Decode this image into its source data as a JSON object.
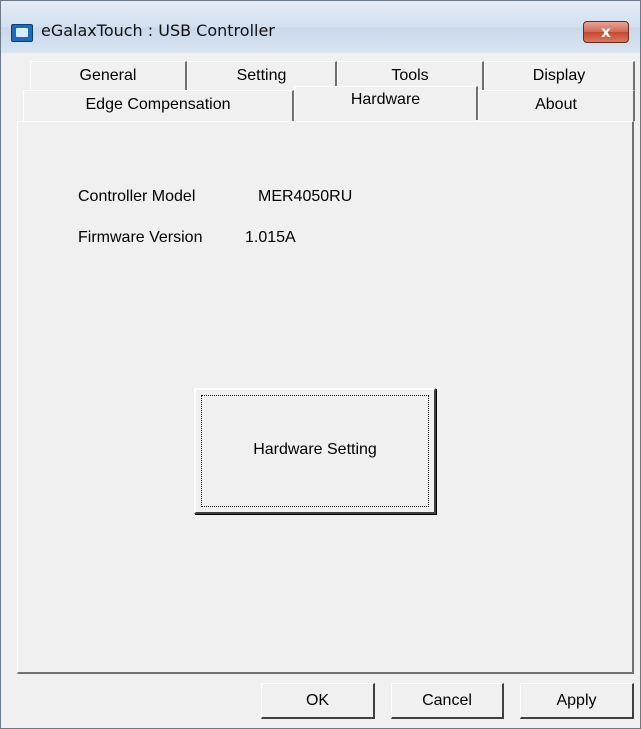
{
  "window": {
    "title": "eGalaxTouch : USB Controller",
    "close_glyph": "x"
  },
  "tabs": {
    "row_back": [
      {
        "label": "General"
      },
      {
        "label": "Setting"
      },
      {
        "label": "Tools"
      },
      {
        "label": "Display"
      }
    ],
    "row_front": [
      {
        "label": "Edge Compensation"
      },
      {
        "label": "Hardware",
        "selected": true
      },
      {
        "label": "About"
      }
    ]
  },
  "hardware": {
    "controller_model_label": "Controller Model",
    "controller_model_value": "MER4050RU",
    "firmware_version_label": "Firmware Version",
    "firmware_version_value": "1.015A",
    "hardware_setting_button": "Hardware Setting"
  },
  "buttons": {
    "ok": "OK",
    "cancel": "Cancel",
    "apply": "Apply"
  },
  "colors": {
    "face": "#f0f0f0",
    "close_button": "#c94a2f"
  }
}
